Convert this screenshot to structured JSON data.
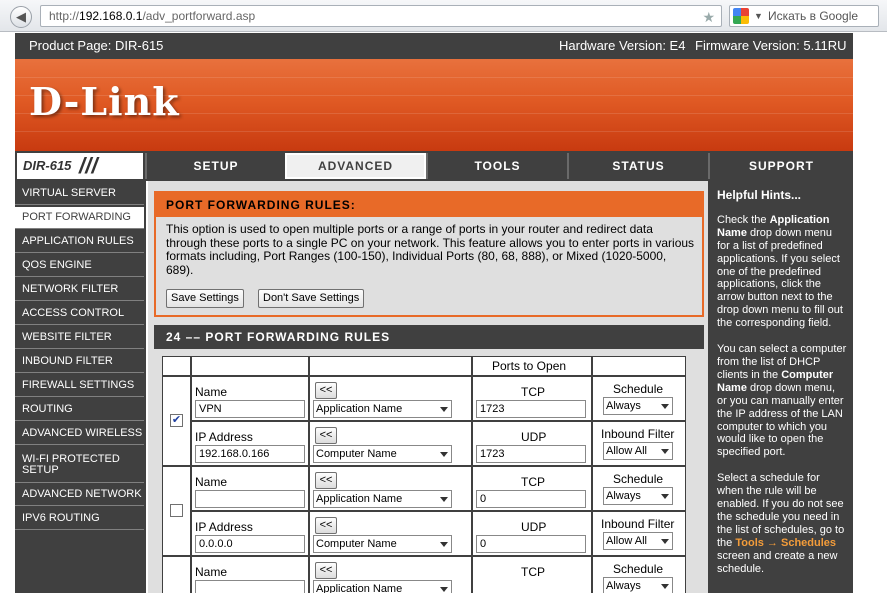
{
  "browser": {
    "url_prefix": "http://",
    "url_host": "192.168.0.1",
    "url_path": "/adv_portforward.asp",
    "search_placeholder": "Искать в Google"
  },
  "header": {
    "product_page": "Product Page: DIR-615",
    "hardware_version": "Hardware Version: E4",
    "firmware_version": "Firmware Version: 5.11RU",
    "logo": "D-Link",
    "model": "DIR-615"
  },
  "tabs": [
    {
      "label": "SETUP"
    },
    {
      "label": "ADVANCED"
    },
    {
      "label": "TOOLS"
    },
    {
      "label": "STATUS"
    },
    {
      "label": "SUPPORT"
    }
  ],
  "active_tab": "ADVANCED",
  "sidebar": {
    "items": [
      {
        "label": "VIRTUAL SERVER"
      },
      {
        "label": "PORT FORWARDING"
      },
      {
        "label": "APPLICATION RULES"
      },
      {
        "label": "QOS ENGINE"
      },
      {
        "label": "NETWORK FILTER"
      },
      {
        "label": "ACCESS CONTROL"
      },
      {
        "label": "WEBSITE FILTER"
      },
      {
        "label": "INBOUND FILTER"
      },
      {
        "label": "FIREWALL SETTINGS"
      },
      {
        "label": "ROUTING"
      },
      {
        "label": "ADVANCED WIRELESS"
      },
      {
        "label": "WI-FI PROTECTED SETUP"
      },
      {
        "label": "ADVANCED NETWORK"
      },
      {
        "label": "IPV6 ROUTING"
      }
    ],
    "active": "PORT FORWARDING"
  },
  "rules": {
    "title": "PORT FORWARDING RULES:",
    "description": "This option is used to open multiple ports or a range of ports in your router and redirect data through these ports to a single PC on your network. This feature allows you to enter ports in various formats including, Port Ranges (100-150), Individual Ports (80, 68, 888), or Mixed (1020-5000, 689).",
    "save_label": "Save Settings",
    "dont_save_label": "Don't Save Settings"
  },
  "table": {
    "title": "24 –– PORT FORWARDING RULES",
    "ports_to_open": "Ports to Open",
    "name_label": "Name",
    "ip_label": "IP Address",
    "tcp_label": "TCP",
    "udp_label": "UDP",
    "schedule_label": "Schedule",
    "inbound_label": "Inbound Filter",
    "arrow_label": "<<",
    "rows": [
      {
        "checked": true,
        "check_mark": "✔",
        "name": "VPN",
        "ip": "192.168.0.166",
        "app_select": "Application Name",
        "computer_select": "Computer Name",
        "tcp": "1723",
        "udp": "1723",
        "schedule": "Always",
        "inbound": "Allow All"
      },
      {
        "checked": false,
        "check_mark": "",
        "name": "",
        "ip": "0.0.0.0",
        "app_select": "Application Name",
        "computer_select": "Computer Name",
        "tcp": "0",
        "udp": "0",
        "schedule": "Always",
        "inbound": "Allow All"
      },
      {
        "checked": false,
        "check_mark": "",
        "name": "",
        "app_select": "Application Name",
        "schedule": "Always"
      }
    ]
  },
  "hints": {
    "title": "Helpful Hints...",
    "p1_a": "Check the ",
    "p1_b": "Application Name",
    "p1_c": " drop down menu for a list of predefined applications. If you select one of the predefined applications, click the arrow button next to the drop down menu to fill out the corresponding field.",
    "p2_a": "You can select a computer from the list of DHCP clients in the ",
    "p2_b": "Computer Name",
    "p2_c": " drop down menu, or you can manually enter the IP address of the LAN computer to which you would like to open the specified port.",
    "p3_a": "Select a schedule for when the rule will be enabled. If you do not see the schedule you need in the list of schedules, go to the ",
    "p3_link": "Tools → Schedules",
    "p3_c": " screen and create a new schedule."
  },
  "colors": {
    "accent_orange": "#e86a28",
    "dark_gray": "#404040",
    "content_bg": "#dfdfdf"
  }
}
